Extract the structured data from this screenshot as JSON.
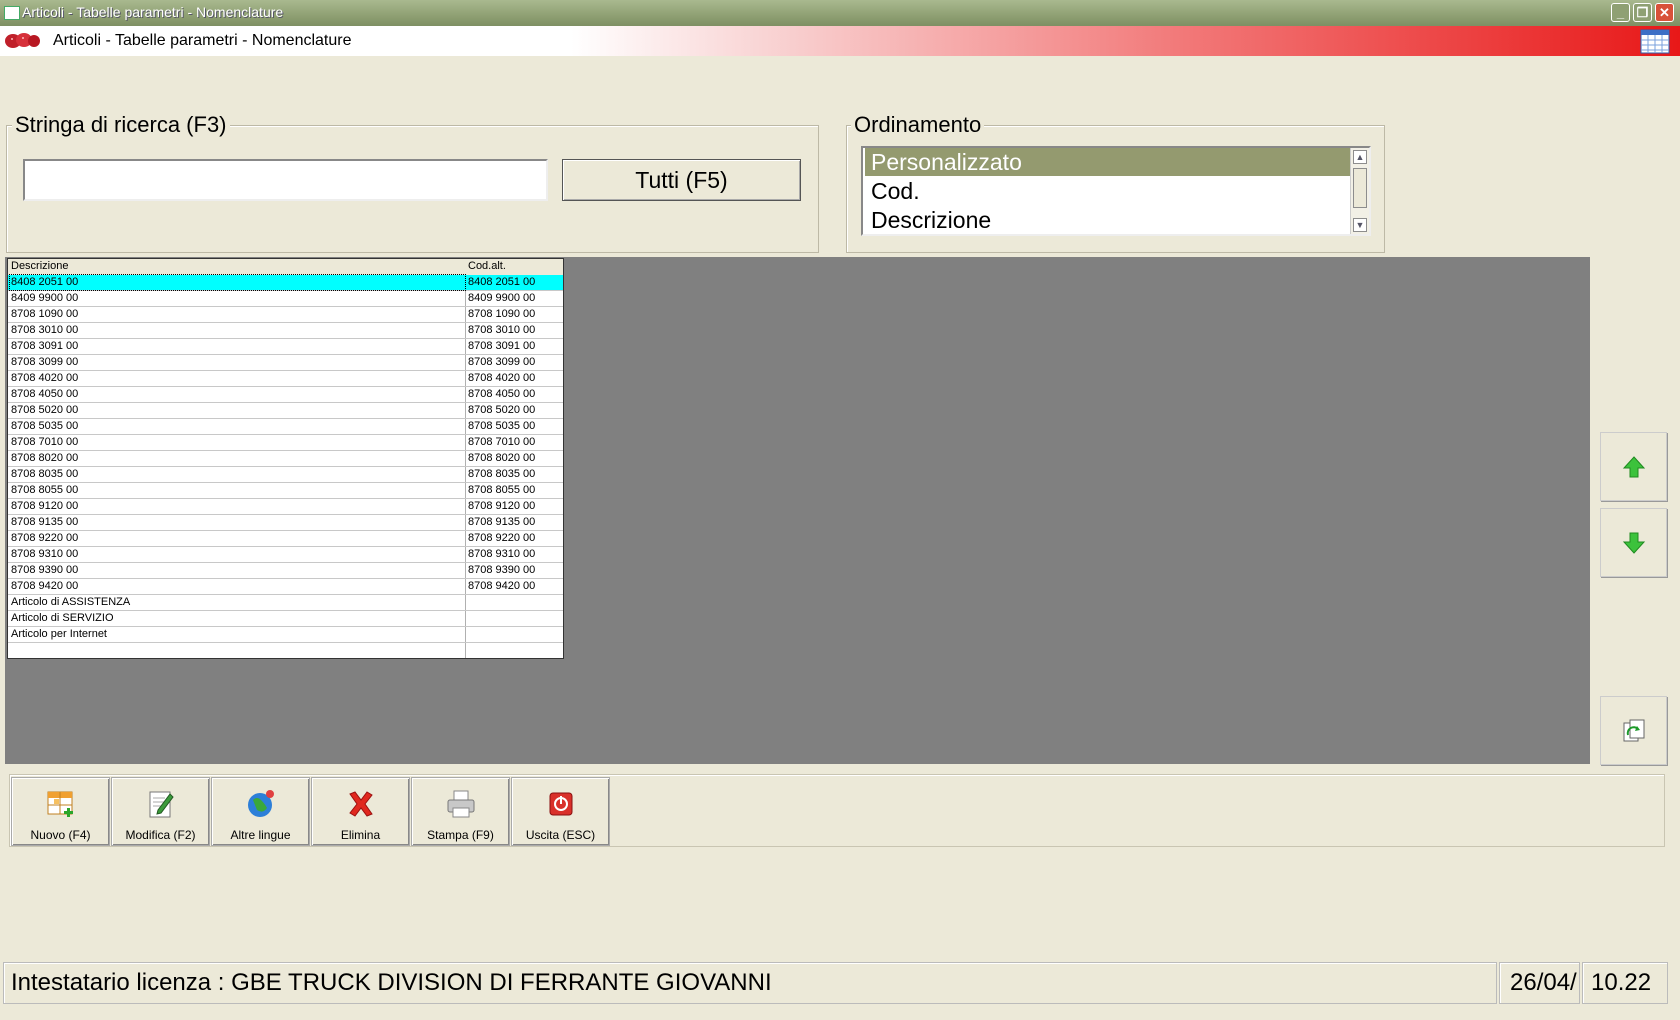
{
  "window": {
    "title": "Articoli - Tabelle parametri - Nomenclature"
  },
  "header": {
    "title": "Articoli - Tabelle parametri - Nomenclature"
  },
  "search": {
    "legend": "Stringa di ricerca (F3)",
    "value": "",
    "button_label": "Tutti (F5)"
  },
  "sort": {
    "legend": "Ordinamento",
    "items": [
      "Personalizzato",
      "Cod.",
      "Descrizione"
    ],
    "selected": "Personalizzato"
  },
  "grid": {
    "headers": [
      "Descrizione",
      "Cod.alt."
    ],
    "rows": [
      [
        "8408 2051 00",
        "8408 2051 00"
      ],
      [
        "8409 9900 00",
        "8409 9900 00"
      ],
      [
        "8708 1090 00",
        "8708 1090 00"
      ],
      [
        "8708 3010 00",
        "8708 3010 00"
      ],
      [
        "8708 3091 00",
        "8708 3091 00"
      ],
      [
        "8708 3099 00",
        "8708 3099 00"
      ],
      [
        "8708 4020 00",
        "8708 4020 00"
      ],
      [
        "8708 4050 00",
        "8708 4050 00"
      ],
      [
        "8708 5020 00",
        "8708 5020 00"
      ],
      [
        "8708 5035 00",
        "8708 5035 00"
      ],
      [
        "8708 7010 00",
        "8708 7010 00"
      ],
      [
        "8708 8020 00",
        "8708 8020 00"
      ],
      [
        "8708 8035 00",
        "8708 8035 00"
      ],
      [
        "8708 8055 00",
        "8708 8055 00"
      ],
      [
        "8708 9120 00",
        "8708 9120 00"
      ],
      [
        "8708 9135 00",
        "8708 9135 00"
      ],
      [
        "8708 9220 00",
        "8708 9220 00"
      ],
      [
        "8708 9310 00",
        "8708 9310 00"
      ],
      [
        "8708 9390 00",
        "8708 9390 00"
      ],
      [
        "8708 9420 00",
        "8708 9420 00"
      ],
      [
        "Articolo di ASSISTENZA",
        ""
      ],
      [
        "Articolo di SERVIZIO",
        ""
      ],
      [
        "Articolo per Internet",
        ""
      ],
      [
        "",
        ""
      ]
    ],
    "selected_row": 0
  },
  "toolbar": {
    "buttons": [
      {
        "label": "Nuovo (F4)",
        "icon": "new-table-icon"
      },
      {
        "label": "Modifica (F2)",
        "icon": "edit-icon"
      },
      {
        "label": "Altre lingue",
        "icon": "globe-icon"
      },
      {
        "label": "Elimina",
        "icon": "delete-icon"
      },
      {
        "label": "Stampa (F9)",
        "icon": "printer-icon"
      },
      {
        "label": "Uscita (ESC)",
        "icon": "exit-icon"
      }
    ]
  },
  "side_buttons": [
    "up-arrow-icon",
    "down-arrow-icon",
    "refresh-icon"
  ],
  "status": {
    "license": "Intestatario licenza : GBE TRUCK DIVISION DI FERRANTE GIOVANNI",
    "date": "26/04/",
    "time": "10.22"
  },
  "colors": {
    "selected_row": "#00FFFF",
    "selected_sort": "#949A6F",
    "panel_bg": "#808080",
    "window_bg": "#ECE9D8"
  }
}
